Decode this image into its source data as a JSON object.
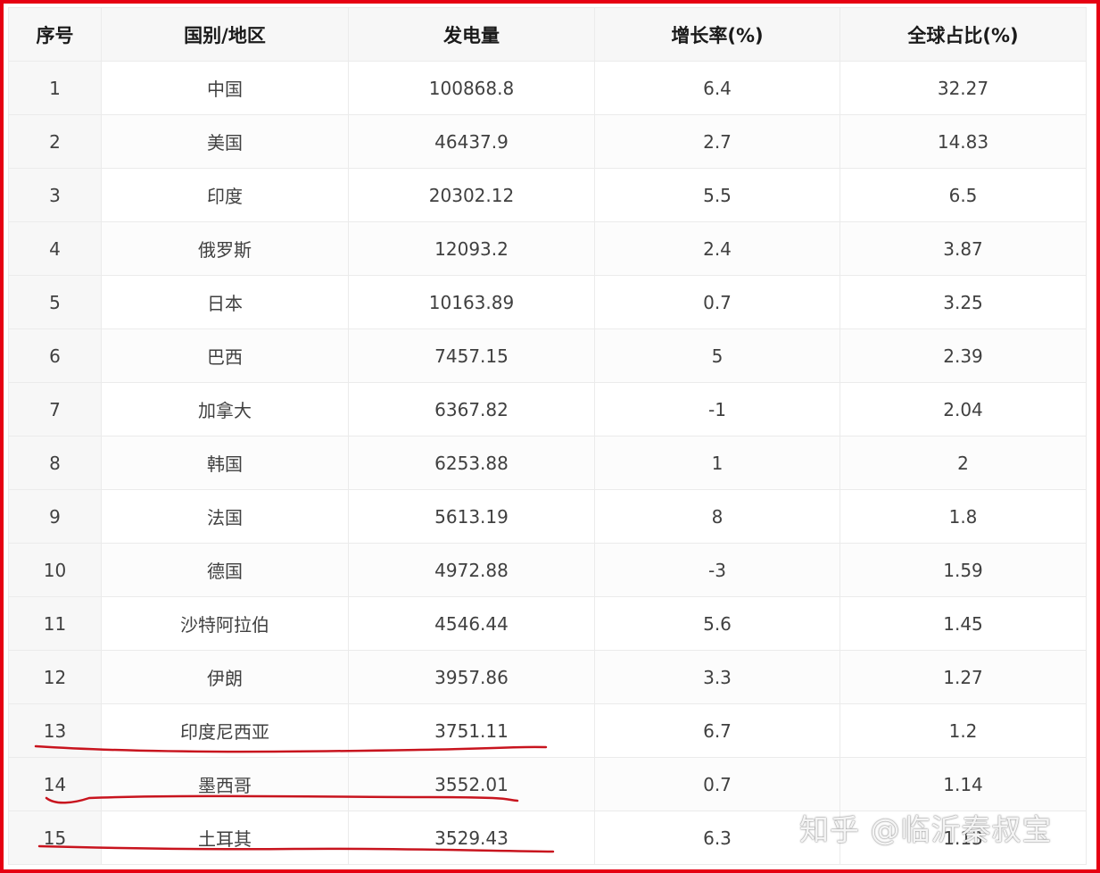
{
  "table": {
    "headers": [
      "序号",
      "国别/地区",
      "发电量",
      "增长率(%)",
      "全球占比(%)"
    ],
    "rows": [
      [
        "1",
        "中国",
        "100868.8",
        "6.4",
        "32.27"
      ],
      [
        "2",
        "美国",
        "46437.9",
        "2.7",
        "14.83"
      ],
      [
        "3",
        "印度",
        "20302.12",
        "5.5",
        "6.5"
      ],
      [
        "4",
        "俄罗斯",
        "12093.2",
        "2.4",
        "3.87"
      ],
      [
        "5",
        "日本",
        "10163.89",
        "0.7",
        "3.25"
      ],
      [
        "6",
        "巴西",
        "7457.15",
        "5",
        "2.39"
      ],
      [
        "7",
        "加拿大",
        "6367.82",
        "-1",
        "2.04"
      ],
      [
        "8",
        "韩国",
        "6253.88",
        "1",
        "2"
      ],
      [
        "9",
        "法国",
        "5613.19",
        "8",
        "1.8"
      ],
      [
        "10",
        "德国",
        "4972.88",
        "-3",
        "1.59"
      ],
      [
        "11",
        "沙特阿拉伯",
        "4546.44",
        "5.6",
        "1.45"
      ],
      [
        "12",
        "伊朗",
        "3957.86",
        "3.3",
        "1.27"
      ],
      [
        "13",
        "印度尼西亚",
        "3751.11",
        "6.7",
        "1.2"
      ],
      [
        "14",
        "墨西哥",
        "3552.01",
        "0.7",
        "1.14"
      ],
      [
        "15",
        "土耳其",
        "3529.43",
        "6.3",
        "1.13"
      ]
    ]
  },
  "watermark": "知乎 @临沂秦叔宝",
  "colors": {
    "frame": "#e60012",
    "underline": "#c8141e",
    "header_bg": "#f7f7f7",
    "grid": "#ebebeb"
  }
}
